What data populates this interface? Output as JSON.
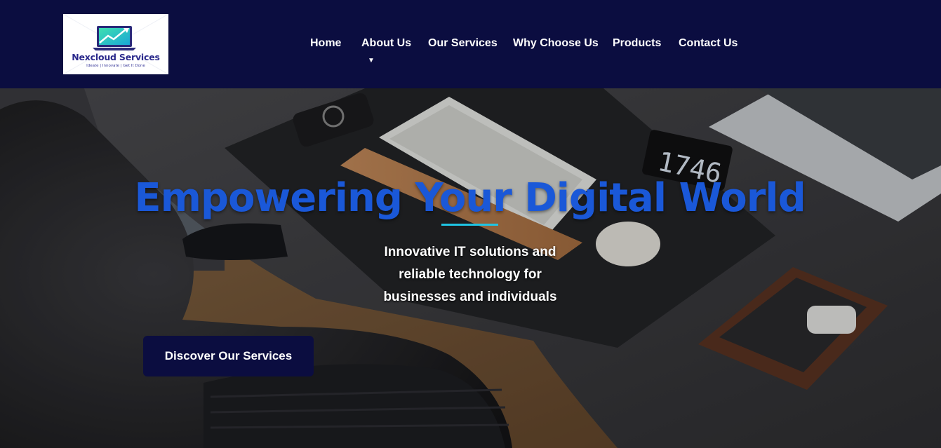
{
  "brand": {
    "name": "Nexcloud Services",
    "tagline": "Ideate | Innovate | Get It Done",
    "logo_icon": "laptop-chart-icon"
  },
  "nav": {
    "items": [
      {
        "label": "Home"
      },
      {
        "label": "About Us",
        "has_dropdown": true
      },
      {
        "label": "Our Services"
      },
      {
        "label": "Why Choose Us"
      },
      {
        "label": "Products"
      },
      {
        "label": "Contact Us"
      }
    ],
    "dropdown_glyph": "▼"
  },
  "hero": {
    "title": "Empowering Your Digital World",
    "subtitle_lines": [
      "Innovative IT solutions and",
      "reliable technology for",
      "businesses and individuals"
    ],
    "cta_label": "Discover Our Services",
    "background": "desk-workspace-photo"
  },
  "colors": {
    "header_bg": "#0b0d40",
    "title": "#1a58d8",
    "accent_rule": "#1fc4e3",
    "button_bg": "#0b0d40"
  }
}
